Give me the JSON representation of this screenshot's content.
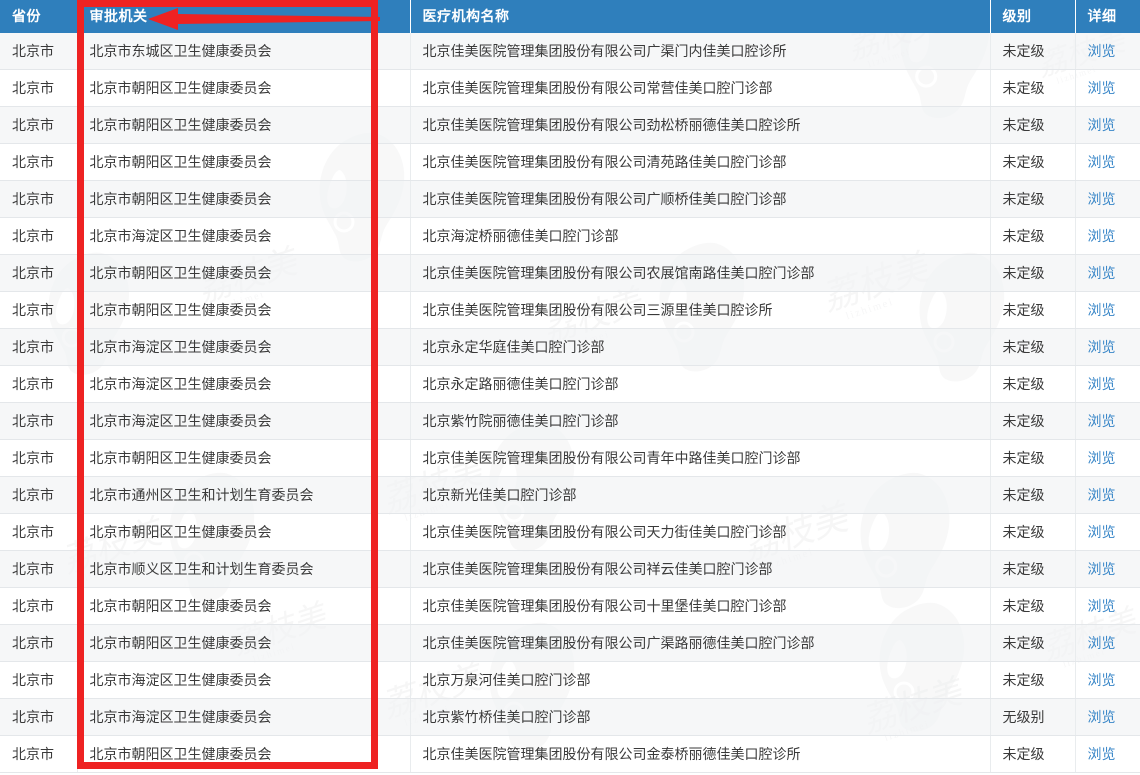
{
  "table": {
    "columns": [
      {
        "key": "province",
        "label": "省份"
      },
      {
        "key": "authority",
        "label": "审批机关"
      },
      {
        "key": "institution",
        "label": "医疗机构名称"
      },
      {
        "key": "level",
        "label": "级别"
      },
      {
        "key": "detail",
        "label": "详细"
      }
    ],
    "detail_link_label": "浏览",
    "rows": [
      {
        "province": "北京市",
        "authority": "北京市东城区卫生健康委员会",
        "institution": "北京佳美医院管理集团股份有限公司广渠门内佳美口腔诊所",
        "level": "未定级",
        "detail": "浏览"
      },
      {
        "province": "北京市",
        "authority": "北京市朝阳区卫生健康委员会",
        "institution": "北京佳美医院管理集团股份有限公司常营佳美口腔门诊部",
        "level": "未定级",
        "detail": "浏览"
      },
      {
        "province": "北京市",
        "authority": "北京市朝阳区卫生健康委员会",
        "institution": "北京佳美医院管理集团股份有限公司劲松桥丽德佳美口腔诊所",
        "level": "未定级",
        "detail": "浏览"
      },
      {
        "province": "北京市",
        "authority": "北京市朝阳区卫生健康委员会",
        "institution": "北京佳美医院管理集团股份有限公司清苑路佳美口腔门诊部",
        "level": "未定级",
        "detail": "浏览"
      },
      {
        "province": "北京市",
        "authority": "北京市朝阳区卫生健康委员会",
        "institution": "北京佳美医院管理集团股份有限公司广顺桥佳美口腔门诊部",
        "level": "未定级",
        "detail": "浏览"
      },
      {
        "province": "北京市",
        "authority": "北京市海淀区卫生健康委员会",
        "institution": "北京海淀桥丽德佳美口腔门诊部",
        "level": "未定级",
        "detail": "浏览"
      },
      {
        "province": "北京市",
        "authority": "北京市朝阳区卫生健康委员会",
        "institution": "北京佳美医院管理集团股份有限公司农展馆南路佳美口腔门诊部",
        "level": "未定级",
        "detail": "浏览"
      },
      {
        "province": "北京市",
        "authority": "北京市朝阳区卫生健康委员会",
        "institution": "北京佳美医院管理集团股份有限公司三源里佳美口腔诊所",
        "level": "未定级",
        "detail": "浏览"
      },
      {
        "province": "北京市",
        "authority": "北京市海淀区卫生健康委员会",
        "institution": "北京永定华庭佳美口腔门诊部",
        "level": "未定级",
        "detail": "浏览"
      },
      {
        "province": "北京市",
        "authority": "北京市海淀区卫生健康委员会",
        "institution": "北京永定路丽德佳美口腔门诊部",
        "level": "未定级",
        "detail": "浏览"
      },
      {
        "province": "北京市",
        "authority": "北京市海淀区卫生健康委员会",
        "institution": "北京紫竹院丽德佳美口腔门诊部",
        "level": "未定级",
        "detail": "浏览"
      },
      {
        "province": "北京市",
        "authority": "北京市朝阳区卫生健康委员会",
        "institution": "北京佳美医院管理集团股份有限公司青年中路佳美口腔门诊部",
        "level": "未定级",
        "detail": "浏览"
      },
      {
        "province": "北京市",
        "authority": "北京市通州区卫生和计划生育委员会",
        "institution": "北京新光佳美口腔门诊部",
        "level": "未定级",
        "detail": "浏览"
      },
      {
        "province": "北京市",
        "authority": "北京市朝阳区卫生健康委员会",
        "institution": "北京佳美医院管理集团股份有限公司天力街佳美口腔门诊部",
        "level": "未定级",
        "detail": "浏览"
      },
      {
        "province": "北京市",
        "authority": "北京市顺义区卫生和计划生育委员会",
        "institution": "北京佳美医院管理集团股份有限公司祥云佳美口腔门诊部",
        "level": "未定级",
        "detail": "浏览"
      },
      {
        "province": "北京市",
        "authority": "北京市朝阳区卫生健康委员会",
        "institution": "北京佳美医院管理集团股份有限公司十里堡佳美口腔门诊部",
        "level": "未定级",
        "detail": "浏览"
      },
      {
        "province": "北京市",
        "authority": "北京市朝阳区卫生健康委员会",
        "institution": "北京佳美医院管理集团股份有限公司广渠路丽德佳美口腔门诊部",
        "level": "未定级",
        "detail": "浏览"
      },
      {
        "province": "北京市",
        "authority": "北京市海淀区卫生健康委员会",
        "institution": "北京万泉河佳美口腔门诊部",
        "level": "未定级",
        "detail": "浏览"
      },
      {
        "province": "北京市",
        "authority": "北京市海淀区卫生健康委员会",
        "institution": "北京紫竹桥佳美口腔门诊部",
        "level": "无级别",
        "detail": "浏览"
      },
      {
        "province": "北京市",
        "authority": "北京市朝阳区卫生健康委员会",
        "institution": "北京佳美医院管理集团股份有限公司金泰桥丽德佳美口腔诊所",
        "level": "未定级",
        "detail": "浏览"
      }
    ]
  },
  "annotation": {
    "highlight_color": "#ee2222",
    "arrow_color": "#ee2222",
    "highlighted_column": "审批机关"
  },
  "watermark": {
    "text": "荔枝美",
    "subtext": "lizhimei",
    "color": "#d8d9db"
  },
  "colors": {
    "header_background": "#2f7fbc",
    "header_text": "#ffffff",
    "row_odd": "#f4f5f6",
    "row_even": "#ffffff",
    "body_text": "#3a3a3a",
    "link": "#3a87c8"
  }
}
